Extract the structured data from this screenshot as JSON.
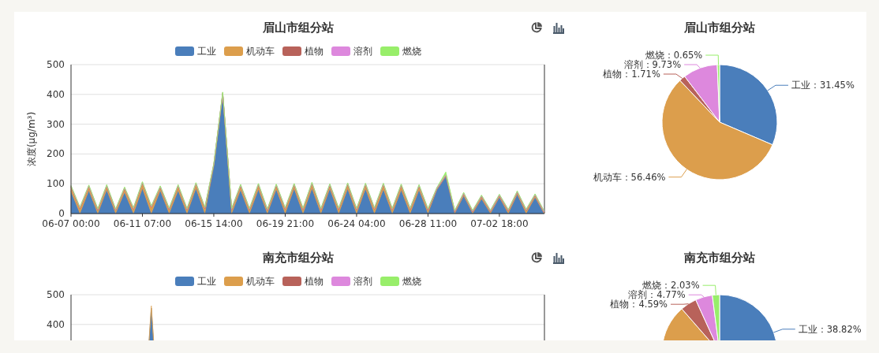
{
  "panels": [
    {
      "title": "眉山市组分站",
      "trend": {
        "chart_data": {
          "type": "area",
          "stacked": true,
          "grid": true,
          "ylabel": "浓度(μg/m³)",
          "ylim": [
            0,
            500
          ],
          "yticks": [
            0,
            100,
            200,
            300,
            400,
            500
          ],
          "categories": [
            "06-07 00:00",
            null,
            null,
            null,
            null,
            null,
            null,
            null,
            "06-11 07:00",
            null,
            null,
            null,
            null,
            null,
            null,
            null,
            "06-15 14:00",
            null,
            null,
            null,
            null,
            null,
            null,
            null,
            "06-19 21:00",
            null,
            null,
            null,
            null,
            null,
            null,
            null,
            "06-24 04:00",
            null,
            null,
            null,
            null,
            null,
            null,
            null,
            "06-28 11:00",
            null,
            null,
            null,
            null,
            null,
            null,
            null,
            "07-02 18:00",
            null,
            null,
            null,
            null,
            null
          ],
          "series": [
            {
              "name": "工业",
              "color": "#4a7ebb",
              "values": [
                75,
                1,
                78,
                1,
                80,
                1,
                72,
                1,
                85,
                1,
                78,
                1,
                78,
                1,
                85,
                1,
                160,
                400,
                1,
                80,
                1,
                82,
                1,
                82,
                1,
                84,
                1,
                85,
                1,
                84,
                1,
                84,
                1,
                84,
                1,
                82,
                1,
                80,
                1,
                80,
                2,
                80,
                125,
                1,
                60,
                1,
                50,
                1,
                55,
                1,
                65,
                1,
                55,
                1
              ]
            },
            {
              "name": "机动车",
              "color": "#dc9e4c",
              "values": [
                14,
                16,
                13,
                11,
                12,
                10,
                12,
                14,
                17,
                20,
                10,
                13,
                14,
                12,
                14,
                16,
                3,
                3,
                12,
                13,
                12,
                14,
                10,
                12,
                14,
                12,
                13,
                15,
                12,
                11,
                13,
                14,
                12,
                13,
                14,
                15,
                12,
                14,
                13,
                12,
                10,
                3,
                3,
                5,
                6,
                5,
                7,
                6,
                5,
                8,
                6,
                9,
                6,
                4
              ]
            },
            {
              "name": "植物",
              "color": "#b8625a",
              "values": [
                1,
                1,
                1,
                1,
                1,
                1,
                1,
                1,
                1,
                1,
                1,
                1,
                1,
                1,
                1,
                1,
                1,
                1,
                1,
                1,
                1,
                1,
                1,
                1,
                1,
                1,
                1,
                1,
                1,
                1,
                1,
                1,
                1,
                1,
                1,
                1,
                1,
                1,
                1,
                1,
                1,
                1,
                1,
                1,
                1,
                1,
                1,
                1,
                1,
                1,
                1,
                1,
                1,
                1
              ]
            },
            {
              "name": "溶剂",
              "color": "#dd88dd",
              "values": [
                3,
                3,
                3,
                3,
                3,
                3,
                3,
                3,
                3,
                3,
                3,
                3,
                3,
                3,
                3,
                3,
                3,
                3,
                3,
                3,
                3,
                3,
                3,
                3,
                3,
                3,
                3,
                3,
                3,
                3,
                3,
                3,
                3,
                3,
                3,
                3,
                3,
                3,
                3,
                3,
                3,
                3,
                3,
                3,
                3,
                3,
                3,
                3,
                3,
                3,
                3,
                3,
                3,
                3
              ]
            },
            {
              "name": "燃烧",
              "color": "#98ee6a",
              "values": [
                1,
                1,
                1,
                1,
                1,
                1,
                1,
                1,
                1,
                1,
                1,
                1,
                1,
                1,
                1,
                1,
                1,
                1,
                1,
                1,
                1,
                1,
                1,
                1,
                1,
                1,
                1,
                1,
                1,
                1,
                1,
                1,
                1,
                1,
                1,
                1,
                1,
                1,
                1,
                1,
                1,
                1,
                8,
                1,
                1,
                1,
                1,
                1,
                1,
                1,
                1,
                1,
                1,
                1
              ]
            }
          ]
        }
      },
      "pie": {
        "chart_data": {
          "type": "pie",
          "title": "眉山市组分站",
          "categories": [
            "工业",
            "机动车",
            "植物",
            "溶剂",
            "燃烧"
          ],
          "values": [
            31.45,
            56.46,
            1.71,
            9.73,
            0.65
          ],
          "colors": [
            "#4a7ebb",
            "#dc9e4c",
            "#b8625a",
            "#dd88dd",
            "#98ee6a"
          ],
          "value_labels": [
            "：31.45%",
            "：56.46%",
            "：1.71%",
            "：9.73%",
            "：0.65%"
          ]
        }
      }
    },
    {
      "title": "南充市组分站",
      "trend": {
        "chart_data": {
          "type": "area",
          "stacked": true,
          "grid": true,
          "ylim": [
            0,
            500
          ],
          "yticks": [
            400,
            500
          ],
          "categories": [
            null,
            null,
            null,
            null,
            null,
            null,
            null,
            null,
            null,
            null,
            null,
            null,
            null,
            null,
            null,
            null,
            null,
            null,
            null,
            null,
            null,
            null,
            null,
            null,
            null,
            null,
            null,
            null,
            null,
            null,
            null,
            null,
            null,
            null,
            null,
            null,
            null,
            null,
            null,
            null,
            null,
            null,
            null,
            null,
            null,
            null,
            null,
            null,
            null,
            null,
            null,
            null,
            null,
            null
          ],
          "series": [
            {
              "name": "工业",
              "color": "#4a7ebb",
              "values": [
                3,
                3,
                3,
                3,
                3,
                3,
                3,
                3,
                3,
                455,
                3,
                3,
                3,
                3,
                3,
                3,
                3,
                3,
                3,
                3,
                3,
                3,
                3,
                3,
                3,
                3,
                3,
                3,
                3,
                3,
                3,
                3,
                3,
                3,
                3,
                3,
                3,
                3,
                3,
                3,
                3,
                3,
                3,
                3,
                3,
                3,
                3,
                3,
                3,
                3,
                3,
                3,
                3,
                3
              ]
            },
            {
              "name": "机动车",
              "color": "#dc9e4c",
              "values": [
                10,
                10,
                10,
                10,
                10,
                10,
                10,
                10,
                10,
                8,
                10,
                10,
                10,
                10,
                10,
                10,
                10,
                10,
                10,
                10,
                10,
                10,
                10,
                10,
                10,
                10,
                10,
                10,
                10,
                10,
                10,
                10,
                10,
                10,
                10,
                10,
                10,
                10,
                10,
                10,
                10,
                10,
                10,
                10,
                10,
                10,
                10,
                10,
                10,
                10,
                10,
                10,
                10,
                10
              ]
            },
            {
              "name": "植物",
              "color": "#b8625a",
              "values": [
                null,
                null,
                null,
                null,
                null,
                null,
                null,
                null,
                null,
                null,
                null,
                null,
                null,
                null,
                null,
                null,
                null,
                null,
                null,
                null,
                null,
                null,
                null,
                null,
                null,
                null,
                null,
                null,
                null,
                null,
                null,
                null,
                null,
                null,
                null,
                null,
                null,
                null,
                null,
                null,
                null,
                null,
                null,
                null,
                null,
                null,
                null,
                null,
                null,
                null,
                null,
                null,
                null,
                null
              ]
            },
            {
              "name": "溶剂",
              "color": "#dd88dd",
              "values": [
                null,
                null,
                null,
                null,
                null,
                null,
                null,
                null,
                null,
                null,
                null,
                null,
                null,
                null,
                null,
                null,
                null,
                null,
                null,
                null,
                null,
                null,
                null,
                null,
                null,
                null,
                null,
                null,
                null,
                null,
                null,
                null,
                null,
                null,
                null,
                null,
                null,
                null,
                null,
                null,
                null,
                null,
                null,
                null,
                null,
                null,
                null,
                null,
                null,
                null,
                null,
                null,
                null,
                null
              ]
            },
            {
              "name": "燃烧",
              "color": "#98ee6a",
              "values": [
                null,
                null,
                null,
                null,
                null,
                null,
                null,
                null,
                null,
                null,
                null,
                null,
                null,
                null,
                null,
                null,
                null,
                null,
                null,
                null,
                null,
                null,
                null,
                null,
                null,
                null,
                null,
                null,
                null,
                null,
                null,
                null,
                null,
                null,
                null,
                null,
                null,
                null,
                null,
                null,
                null,
                null,
                null,
                null,
                null,
                null,
                null,
                null,
                null,
                null,
                null,
                null,
                null,
                null
              ]
            }
          ]
        }
      },
      "pie": {
        "chart_data": {
          "type": "pie",
          "title": "南充市组分站",
          "categories": [
            "工业",
            null,
            "植物",
            "溶剂",
            "燃烧"
          ],
          "values": [
            38.82,
            49.79,
            4.59,
            4.77,
            2.03
          ],
          "colors": [
            "#4a7ebb",
            "#dc9e4c",
            "#b8625a",
            "#dd88dd",
            "#98ee6a"
          ],
          "value_labels": [
            "：38.82%",
            null,
            "：4.59%",
            "：4.77%",
            "：2.03%"
          ]
        }
      }
    }
  ]
}
